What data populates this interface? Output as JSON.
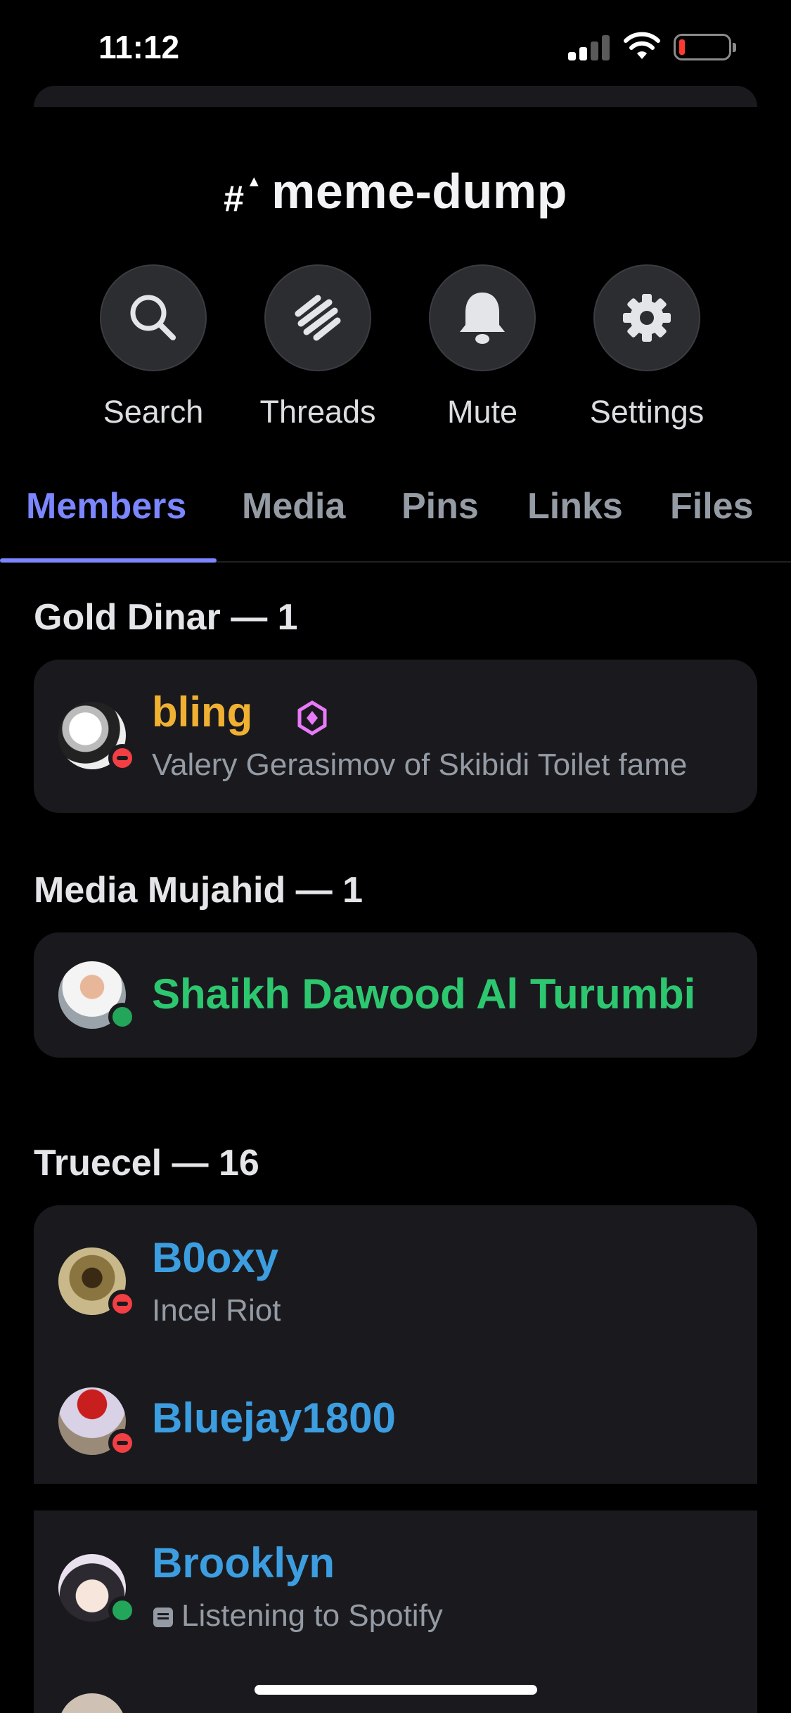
{
  "status_bar": {
    "time": "11:12",
    "battery_color": "#ff3b30"
  },
  "channel": {
    "name": "meme-dump",
    "icon": "locked-hash-icon"
  },
  "actions": [
    {
      "label": "Search",
      "icon": "search-icon"
    },
    {
      "label": "Threads",
      "icon": "threads-icon"
    },
    {
      "label": "Mute",
      "icon": "bell-icon"
    },
    {
      "label": "Settings",
      "icon": "gear-icon"
    }
  ],
  "tabs": [
    {
      "label": "Members",
      "active": true
    },
    {
      "label": "Media"
    },
    {
      "label": "Pins"
    },
    {
      "label": "Links"
    },
    {
      "label": "Files"
    }
  ],
  "sections": [
    {
      "header": "Gold Dinar — 1",
      "members": [
        {
          "name": "bling",
          "name_color": "#f0b132",
          "subtitle": "Valery Gerasimov of Skibidi Toilet fame",
          "status": "dnd",
          "badge": "role-gem-icon"
        }
      ]
    },
    {
      "header": "Media Mujahid — 1",
      "members": [
        {
          "name": "Shaikh Dawood Al Turumbi",
          "name_color": "#2dc770",
          "status": "online"
        }
      ]
    },
    {
      "header": "Truecel — 16",
      "members": [
        {
          "name": "B0oxy",
          "name_color": "#3c9ee0",
          "subtitle": "Incel Riot",
          "status": "dnd"
        },
        {
          "name": "Bluejay1800",
          "name_color": "#3c9ee0",
          "status": "dnd"
        },
        {
          "name": "Brooklyn",
          "name_color": "#3c9ee0",
          "subtitle": "Listening to Spotify",
          "subtitle_icon": "activity-icon",
          "status": "online"
        }
      ]
    }
  ],
  "colors": {
    "accent": "#7b86ff",
    "background": "#000000",
    "card": "#1a1a1e",
    "muted_text": "#949ba4"
  }
}
